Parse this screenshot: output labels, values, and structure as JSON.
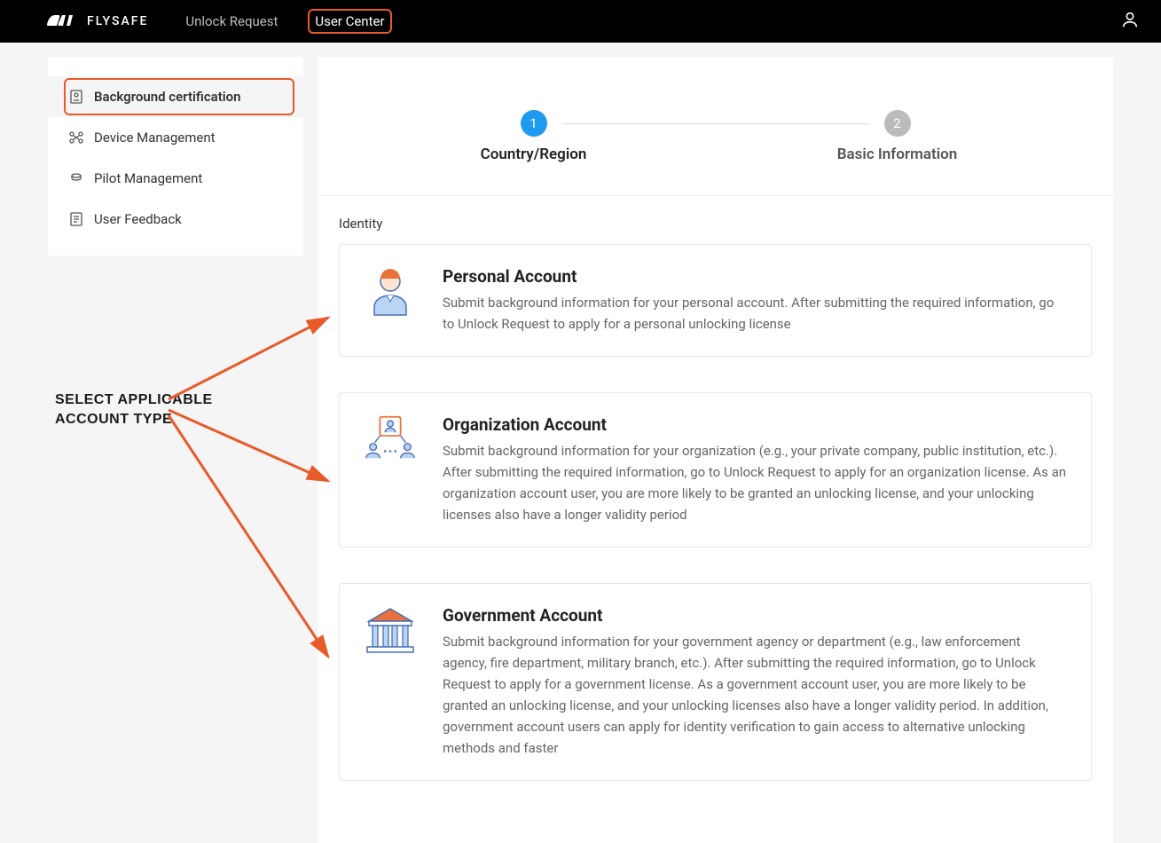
{
  "header": {
    "brand_suffix": "FLYSAFE",
    "nav": {
      "unlock_request": "Unlock Request",
      "user_center": "User Center"
    }
  },
  "sidebar": {
    "items": [
      {
        "label": "Background certification"
      },
      {
        "label": "Device Management"
      },
      {
        "label": "Pilot Management"
      },
      {
        "label": "User Feedback"
      }
    ]
  },
  "steps": {
    "s1_num": "1",
    "s1_label": "Country/Region",
    "s2_num": "2",
    "s2_label": "Basic Information"
  },
  "identity_label": "Identity",
  "cards": {
    "personal": {
      "title": "Personal Account",
      "desc": "Submit background information for your personal account. After submitting the required information, go to Unlock Request to apply for a personal unlocking license"
    },
    "organization": {
      "title": "Organization Account",
      "desc": "Submit background information for your organization (e.g., your private company, public institution, etc.). After submitting the required information, go to Unlock Request to apply for an organization license. As an organization account user, you are more likely to be granted an unlocking license, and your unlocking licenses also have a longer validity period"
    },
    "government": {
      "title": "Government Account",
      "desc": "Submit background information for your government agency or department (e.g., law enforcement agency, fire department, military branch, etc.). After submitting the required information, go to Unlock Request to apply for a government license. As a government account user, you are more likely to be granted an unlocking license, and your unlocking licenses also have a longer validity period. In addition, government account users can apply for identity verification to gain access to alternative unlocking methods and faster"
    }
  },
  "annotation": "SELECT APPLICABLE\nACCOUNT TYPE",
  "colors": {
    "accent": "#1e9bf0",
    "highlight": "#e85a2a",
    "arrow": "#e85a2a"
  }
}
